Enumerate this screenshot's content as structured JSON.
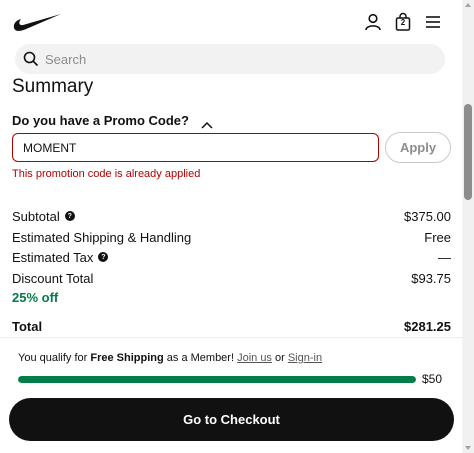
{
  "header": {
    "logo_icon": "nike-swoosh-icon",
    "account_icon": "person-icon",
    "bag_icon": "shopping-bag-icon",
    "bag_count": "2",
    "menu_icon": "hamburger-menu-icon"
  },
  "search": {
    "placeholder": "Search",
    "icon": "search-icon"
  },
  "summary": {
    "title": "Summary",
    "promo": {
      "question": "Do you have a Promo Code?",
      "toggle_icon": "chevron-up-icon",
      "code_value": "MOMENT",
      "apply_label": "Apply",
      "error": "This promotion code is already applied"
    },
    "rows": {
      "subtotal": {
        "label": "Subtotal",
        "value": "$375.00"
      },
      "shipping": {
        "label": "Estimated Shipping & Handling",
        "value": "Free"
      },
      "tax": {
        "label": "Estimated Tax",
        "value": "—"
      },
      "discount": {
        "label": "Discount Total",
        "value": "$93.75",
        "detail": "25% off"
      },
      "total": {
        "label": "Total",
        "value": "$281.25"
      }
    }
  },
  "shipping_banner": {
    "text_prefix": "You qualify for ",
    "text_bold": "Free Shipping",
    "text_middle": " as a Member! ",
    "join_link": "Join us",
    "or_text": " or ",
    "signin_link": "Sign-in",
    "progress_percent": 100,
    "threshold": "$50"
  },
  "checkout": {
    "label": "Go to Checkout"
  },
  "colors": {
    "accent_green": "#007d48",
    "error_red": "#b30000",
    "primary_black": "#111111"
  }
}
